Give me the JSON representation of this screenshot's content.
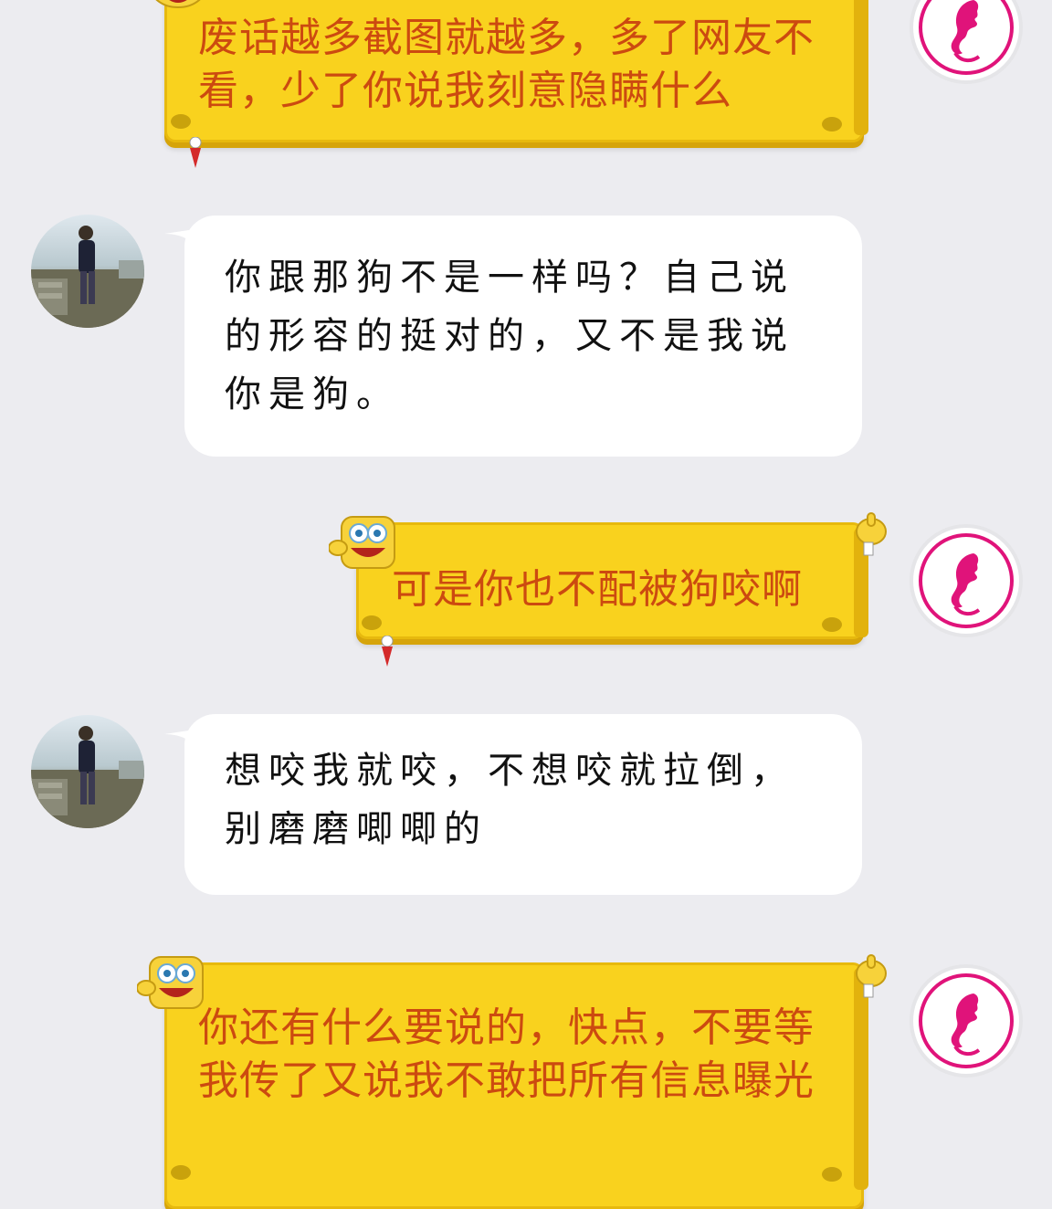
{
  "messages": [
    {
      "id": 1,
      "side": "self",
      "text": "废话越多截图就越多，多了网友不看，少了你说我刻意隐瞒什么"
    },
    {
      "id": 2,
      "side": "other",
      "text": "你跟那狗不是一样吗？自己说的形容的挺对的，又不是我说你是狗。"
    },
    {
      "id": 3,
      "side": "self",
      "text": "可是你也不配被狗咬啊"
    },
    {
      "id": 4,
      "side": "other",
      "text": "想咬我就咬，不想咬就拉倒，别磨磨唧唧的"
    },
    {
      "id": 5,
      "side": "self",
      "text": "你还有什么要说的，快点，不要等我传了又说我不敢把所有信息曝光"
    }
  ],
  "colors": {
    "background": "#ececf0",
    "yellow_bubble": "#f9d21e",
    "yellow_text": "#cc4a10",
    "white_bubble": "#ffffff",
    "brand_pink": "#e0137a"
  },
  "icons": {
    "self_avatar": "woman-profile-logo-icon",
    "other_avatar": "man-photo-avatar",
    "bubble_decoration": "spongebob-sticker-icon"
  }
}
